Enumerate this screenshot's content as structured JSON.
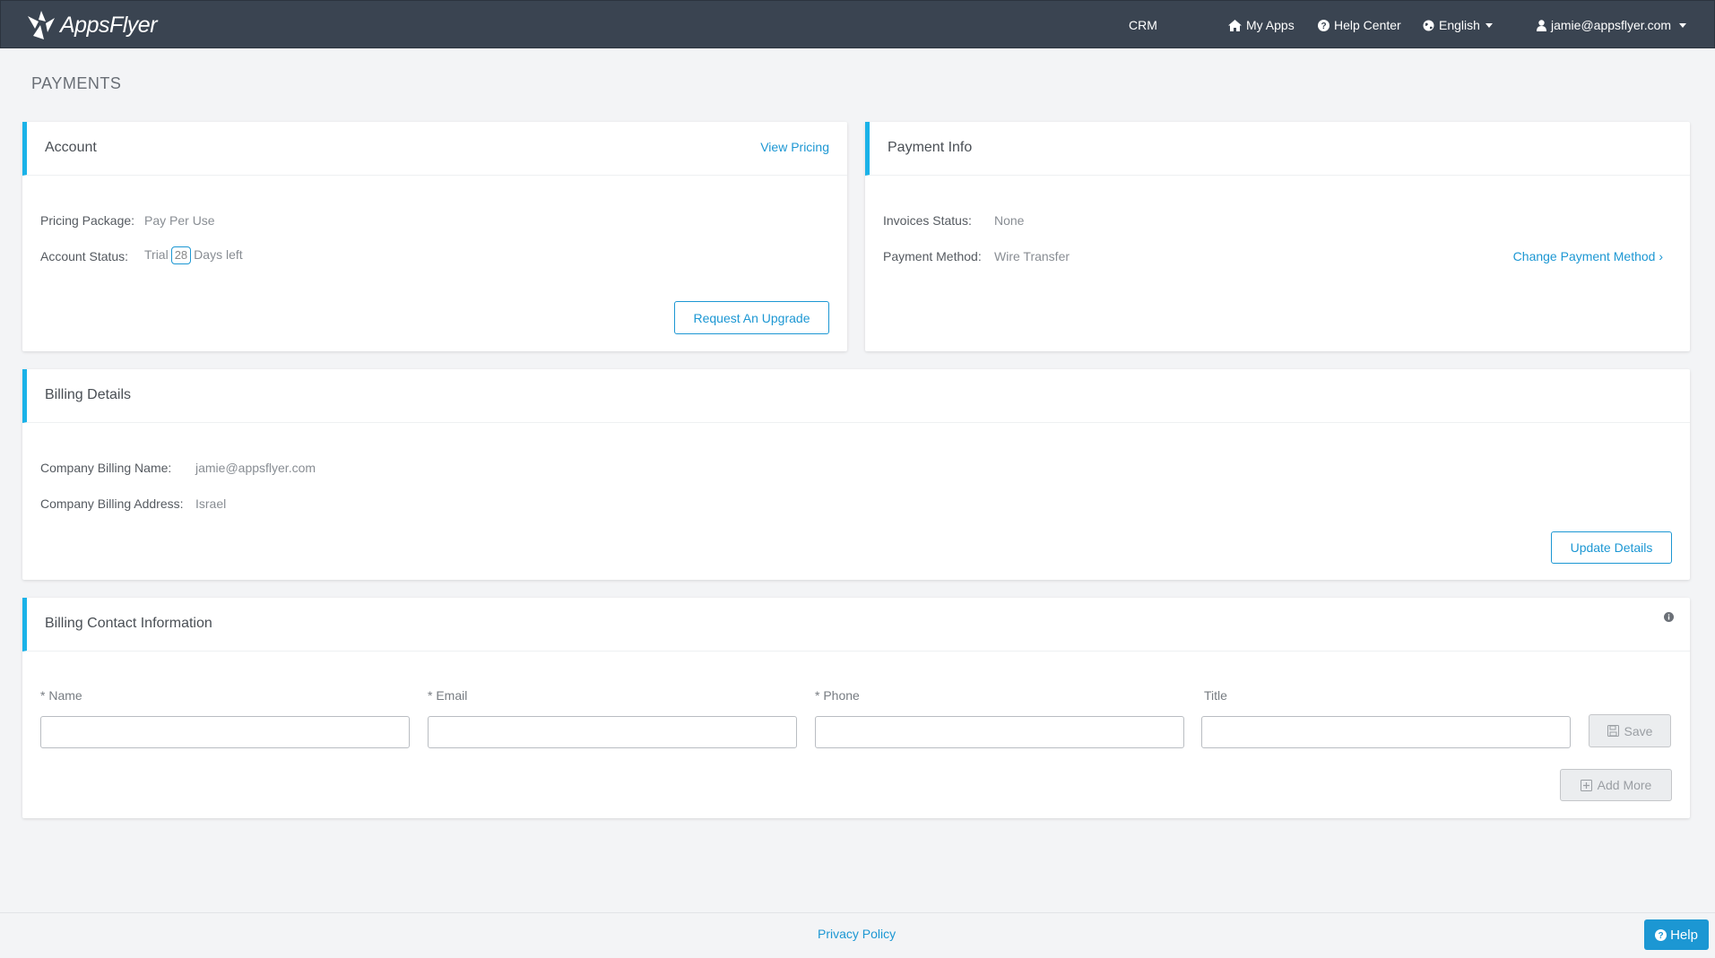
{
  "nav": {
    "logo_text": "AppsFlyer",
    "crm": "CRM",
    "my_apps": "My Apps",
    "help_center": "Help Center",
    "language": "English",
    "user_email": "jamie@appsflyer.com"
  },
  "page_title": "PAYMENTS",
  "account": {
    "title": "Account",
    "view_pricing": "View Pricing",
    "pricing_package_label": "Pricing Package:",
    "pricing_package_value": "Pay Per Use",
    "account_status_label": "Account Status:",
    "status_trial": "Trial",
    "days_count": "28",
    "days_left": "Days left",
    "request_upgrade": "Request An Upgrade"
  },
  "payment_info": {
    "title": "Payment Info",
    "invoices_status_label": "Invoices Status:",
    "invoices_status_value": "None",
    "payment_method_label": "Payment Method:",
    "payment_method_value": "Wire Transfer",
    "change_payment_method": "Change Payment Method ›"
  },
  "billing_details": {
    "title": "Billing Details",
    "company_name_label": "Company Billing Name:",
    "company_name_value": "jamie@appsflyer.com",
    "company_address_label": "Company Billing Address:",
    "company_address_value": "Israel",
    "update_details": "Update Details"
  },
  "billing_contact": {
    "title": "Billing Contact Information",
    "name_label": "* Name",
    "email_label": "* Email",
    "phone_label": "* Phone",
    "title_label": "Title",
    "name_value": "",
    "email_value": "",
    "phone_value": "",
    "title_value": "",
    "save": "Save",
    "add_more": "Add More"
  },
  "footer": {
    "privacy_policy": "Privacy Policy",
    "help": "Help"
  },
  "colors": {
    "navbar": "#3a4451",
    "accent": "#1ab2e8",
    "link": "#1c97d3",
    "background": "#f3f4f6"
  }
}
